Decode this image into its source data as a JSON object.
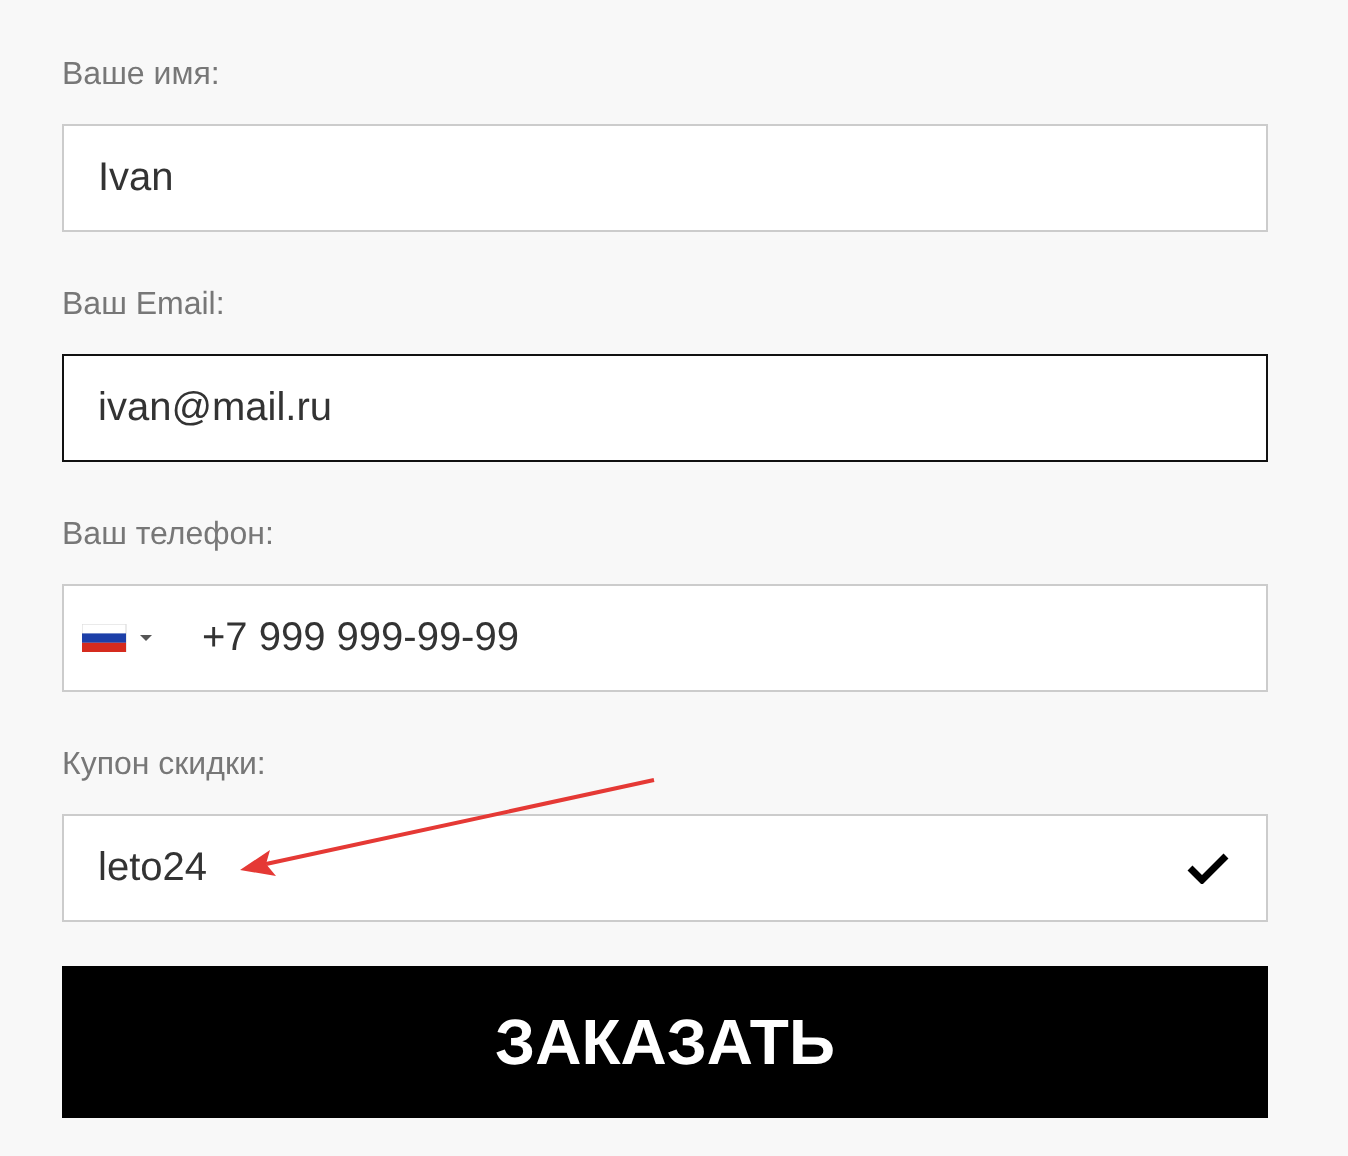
{
  "fields": [
    {
      "kind": "text",
      "label": "Ваше имя:",
      "value": "Ivan",
      "focused": false,
      "valid": false
    },
    {
      "kind": "text",
      "label": "Ваш Email:",
      "value": "ivan@mail.ru",
      "focused": true,
      "valid": false
    },
    {
      "kind": "phone",
      "label": "Ваш телефон:",
      "value": "+7 999 999-99-99",
      "focused": false,
      "valid": false
    },
    {
      "kind": "text",
      "label": "Купон скидки:",
      "value": "leto24",
      "focused": false,
      "valid": true
    }
  ],
  "submit": {
    "label": "ЗАКАЗАТЬ"
  }
}
